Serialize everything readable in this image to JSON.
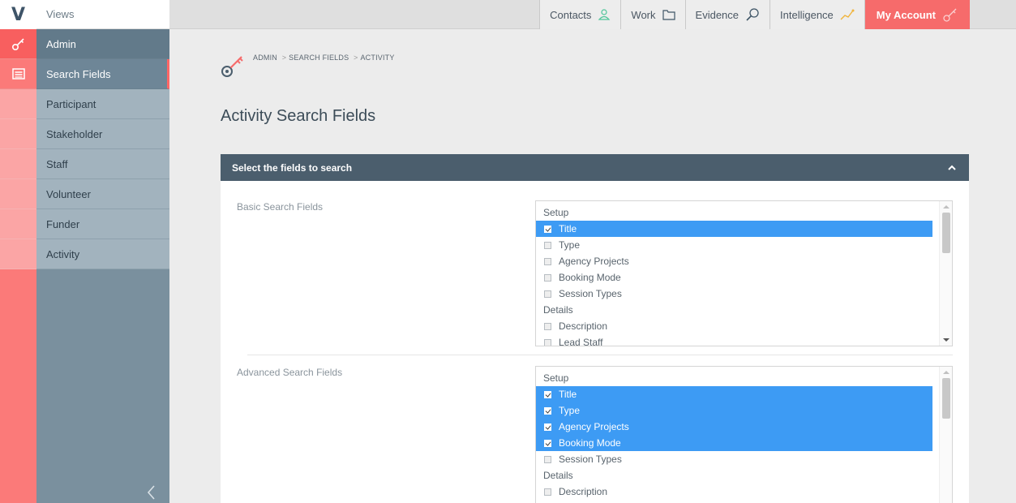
{
  "brand": {
    "logo_letter": "V"
  },
  "rail": {
    "icons": [
      "key-icon",
      "list-icon"
    ]
  },
  "sidebar": {
    "header": "Views",
    "admin": "Admin",
    "search_fields": "Search Fields",
    "items": [
      "Participant",
      "Stakeholder",
      "Staff",
      "Volunteer",
      "Funder",
      "Activity"
    ]
  },
  "topnav": {
    "contacts": "Contacts",
    "work": "Work",
    "evidence": "Evidence",
    "intelligence": "Intelligence",
    "account": "My Account"
  },
  "breadcrumb": {
    "admin": "ADMIN",
    "search_fields": "SEARCH FIELDS",
    "activity": "ACTIVITY",
    "separator": ">"
  },
  "page": {
    "title": "Activity Search Fields"
  },
  "panel": {
    "title": "Select the fields to search",
    "basic": {
      "label": "Basic Search Fields",
      "groups": [
        {
          "name": "Setup",
          "options": [
            {
              "label": "Title",
              "checked": true
            },
            {
              "label": "Type",
              "checked": false
            },
            {
              "label": "Agency Projects",
              "checked": false
            },
            {
              "label": "Booking Mode",
              "checked": false
            },
            {
              "label": "Session Types",
              "checked": false
            }
          ]
        },
        {
          "name": "Details",
          "options": [
            {
              "label": "Description",
              "checked": false
            },
            {
              "label": "Lead Staff",
              "checked": false
            }
          ]
        }
      ]
    },
    "advanced": {
      "label": "Advanced Search Fields",
      "groups": [
        {
          "name": "Setup",
          "options": [
            {
              "label": "Title",
              "checked": true
            },
            {
              "label": "Type",
              "checked": true
            },
            {
              "label": "Agency Projects",
              "checked": true
            },
            {
              "label": "Booking Mode",
              "checked": true
            },
            {
              "label": "Session Types",
              "checked": false
            }
          ]
        },
        {
          "name": "Details",
          "options": [
            {
              "label": "Description",
              "checked": false
            }
          ]
        }
      ]
    }
  },
  "colors": {
    "accent": "#fb7a79",
    "sidebar": "#7a909e",
    "selected": "#3d9bf4",
    "panel_header": "#4b5e6d"
  }
}
